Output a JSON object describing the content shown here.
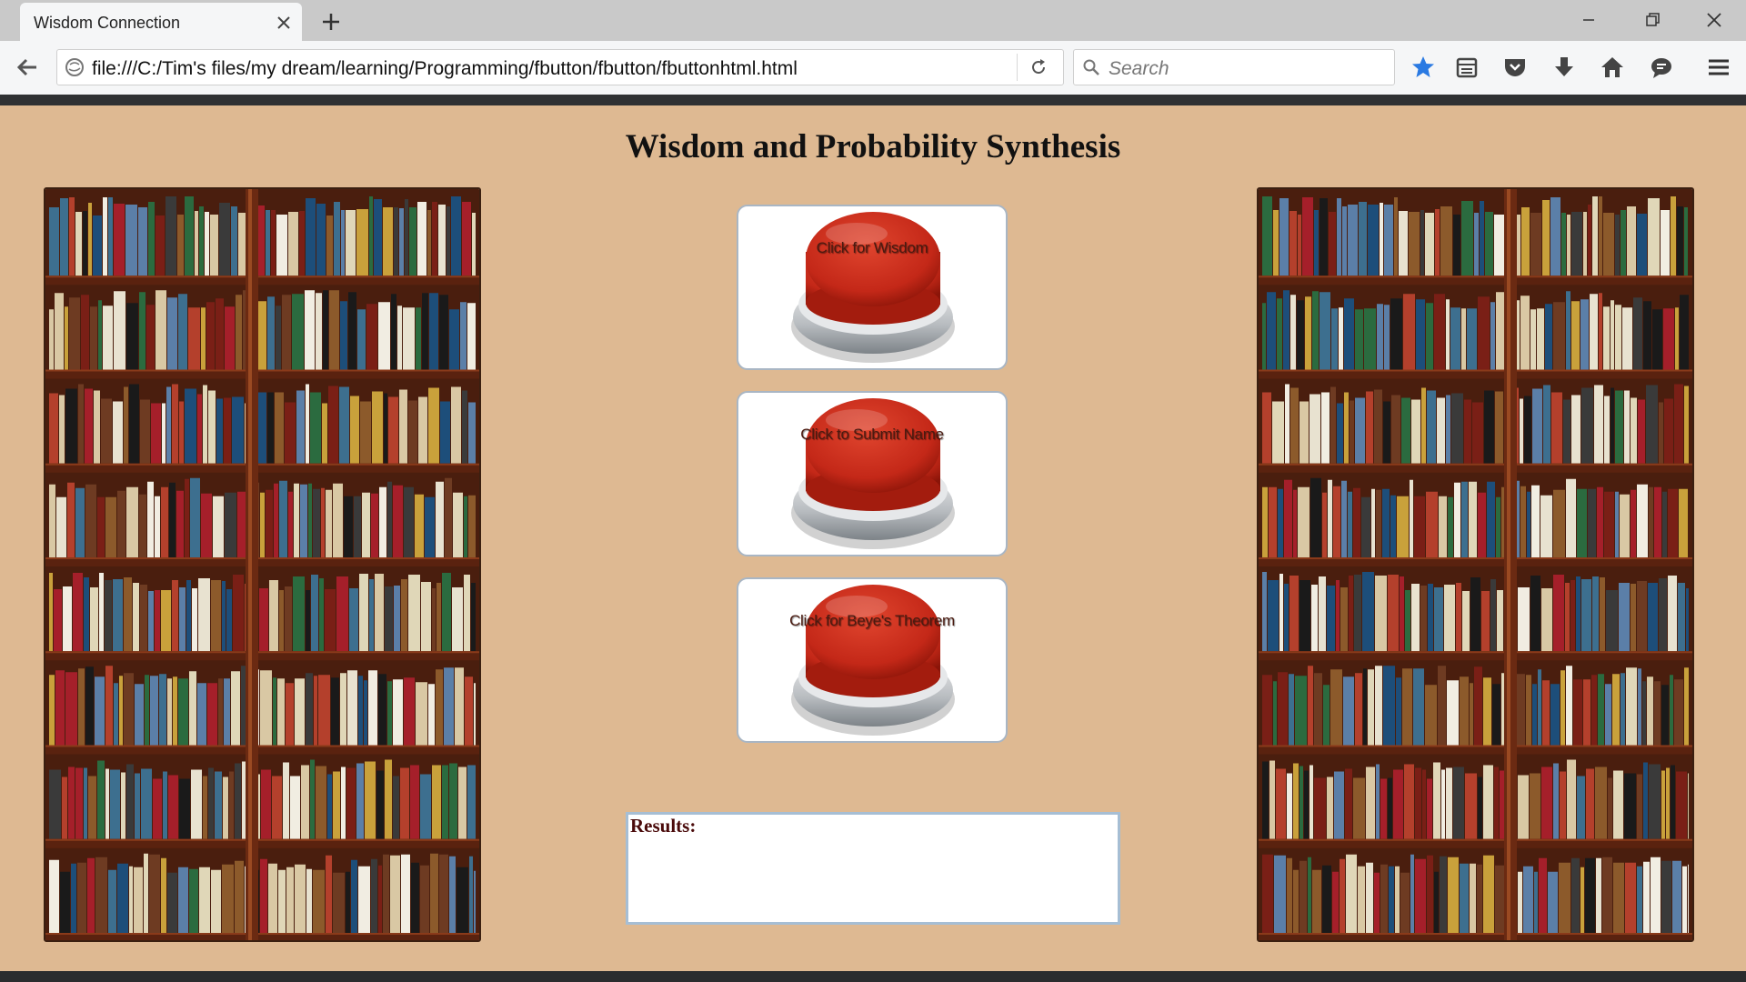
{
  "browser": {
    "tab_title": "Wisdom Connection",
    "url": "file:///C:/Tim's files/my dream/learning/Programming/fbutton/fbutton/fbuttonhtml.html",
    "search_placeholder": "Search",
    "icons": [
      "back-icon",
      "info-icon",
      "reload-icon",
      "search-icon",
      "bookmark-star-icon",
      "reading-list-icon",
      "pocket-icon",
      "download-icon",
      "home-icon",
      "chat-icon",
      "menu-icon",
      "minimize-icon",
      "restore-icon",
      "close-icon",
      "new-tab-icon",
      "tab-close-icon"
    ]
  },
  "page": {
    "title": "Wisdom and Probability Synthesis",
    "buttons": [
      {
        "label": "Click for Wisdom"
      },
      {
        "label": "Click to Submit Name"
      },
      {
        "label": "Click for Beye's Theorem"
      }
    ],
    "results_label": "Results:"
  },
  "colors": {
    "page_background": "#deb992",
    "button_red": "#c42818",
    "accent_blue": "#2a7ae2"
  }
}
